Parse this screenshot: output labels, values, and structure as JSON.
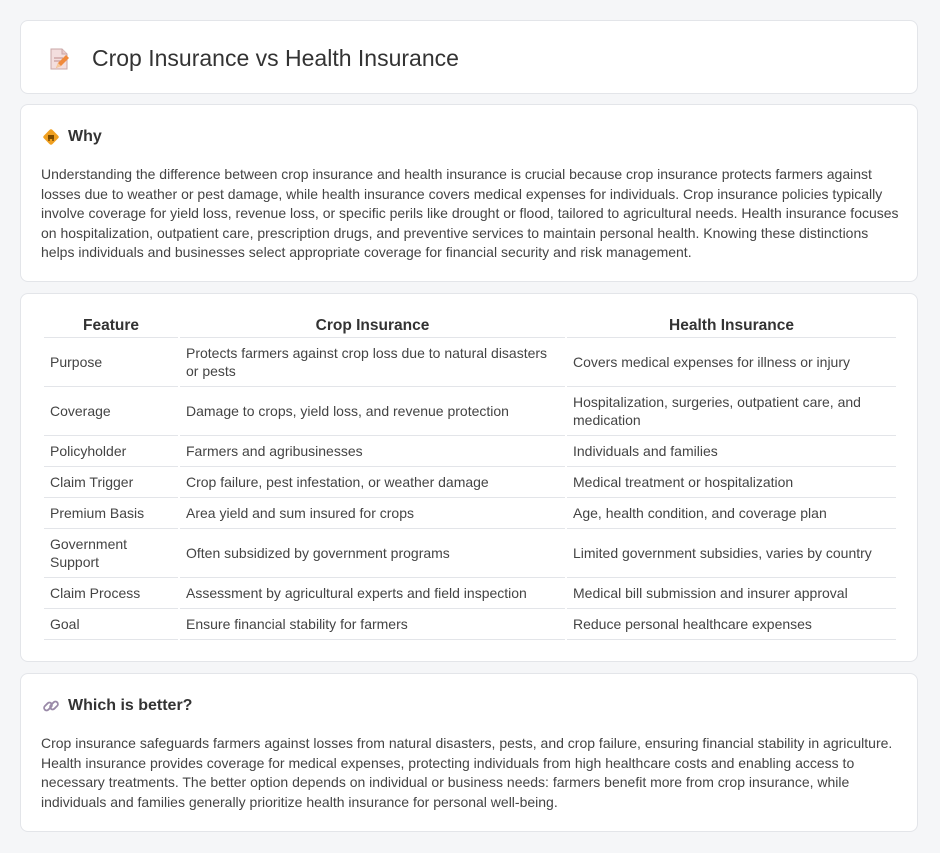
{
  "header": {
    "title": "Crop Insurance vs Health Insurance",
    "icon": "document-edit-icon"
  },
  "why": {
    "title": "Why",
    "icon": "diamond-warning-icon",
    "text": "Understanding the difference between crop insurance and health insurance is crucial because crop insurance protects farmers against losses due to weather or pest damage, while health insurance covers medical expenses for individuals. Crop insurance policies typically involve coverage for yield loss, revenue loss, or specific perils like drought or flood, tailored to agricultural needs. Health insurance focuses on hospitalization, outpatient care, prescription drugs, and preventive services to maintain personal health. Knowing these distinctions helps individuals and businesses select appropriate coverage for financial security and risk management."
  },
  "table": {
    "headers": [
      "Feature",
      "Crop Insurance",
      "Health Insurance"
    ],
    "rows": [
      [
        "Purpose",
        "Protects farmers against crop loss due to natural disasters or pests",
        "Covers medical expenses for illness or injury"
      ],
      [
        "Coverage",
        "Damage to crops, yield loss, and revenue protection",
        "Hospitalization, surgeries, outpatient care, and medication"
      ],
      [
        "Policyholder",
        "Farmers and agribusinesses",
        "Individuals and families"
      ],
      [
        "Claim Trigger",
        "Crop failure, pest infestation, or weather damage",
        "Medical treatment or hospitalization"
      ],
      [
        "Premium Basis",
        "Area yield and sum insured for crops",
        "Age, health condition, and coverage plan"
      ],
      [
        "Government Support",
        "Often subsidized by government programs",
        "Limited government subsidies, varies by country"
      ],
      [
        "Claim Process",
        "Assessment by agricultural experts and field inspection",
        "Medical bill submission and insurer approval"
      ],
      [
        "Goal",
        "Ensure financial stability for farmers",
        "Reduce personal healthcare expenses"
      ]
    ]
  },
  "better": {
    "title": "Which is better?",
    "icon": "link-icon",
    "text": "Crop insurance safeguards farmers against losses from natural disasters, pests, and crop failure, ensuring financial stability in agriculture. Health insurance provides coverage for medical expenses, protecting individuals from high healthcare costs and enabling access to necessary treatments. The better option depends on individual or business needs: farmers benefit more from crop insurance, while individuals and families generally prioritize health insurance for personal well-being."
  },
  "colors": {
    "accent_orange": "#f0a020",
    "icon_pink": "#e8707a",
    "link_gray": "#9a8aa8"
  }
}
